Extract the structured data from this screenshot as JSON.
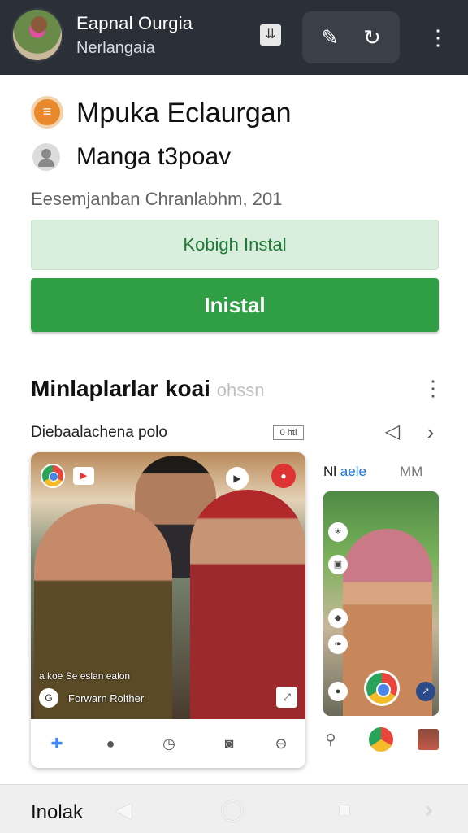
{
  "topbar": {
    "title": "Eapnal Ourgia",
    "subtitle": "Nerlangaia",
    "icons": [
      "download-icon",
      "refresh-icon",
      "more-vert-icon"
    ]
  },
  "app": {
    "name": "Mpuka Eclaurgan",
    "developer": "Manga t3poav",
    "description": "Eesemjanban Chranlabhm, 201",
    "secondary_button": "Kobigh Instal",
    "primary_button": "Inistal",
    "accent": "#2f9e44"
  },
  "section": {
    "title": "Minlaplarlar koai",
    "title_faded": "ohssn",
    "subtitle": "Diebaalachena polo",
    "badge": "0 hti"
  },
  "main_card": {
    "caption": "a koe Se eslan ealon",
    "author": "Forwarn Rolther"
  },
  "side_card": {
    "tab_active_prefix": "Nl",
    "tab_active": "aele",
    "tab_other": "MM"
  },
  "bottom": {
    "label": "Inolak"
  }
}
